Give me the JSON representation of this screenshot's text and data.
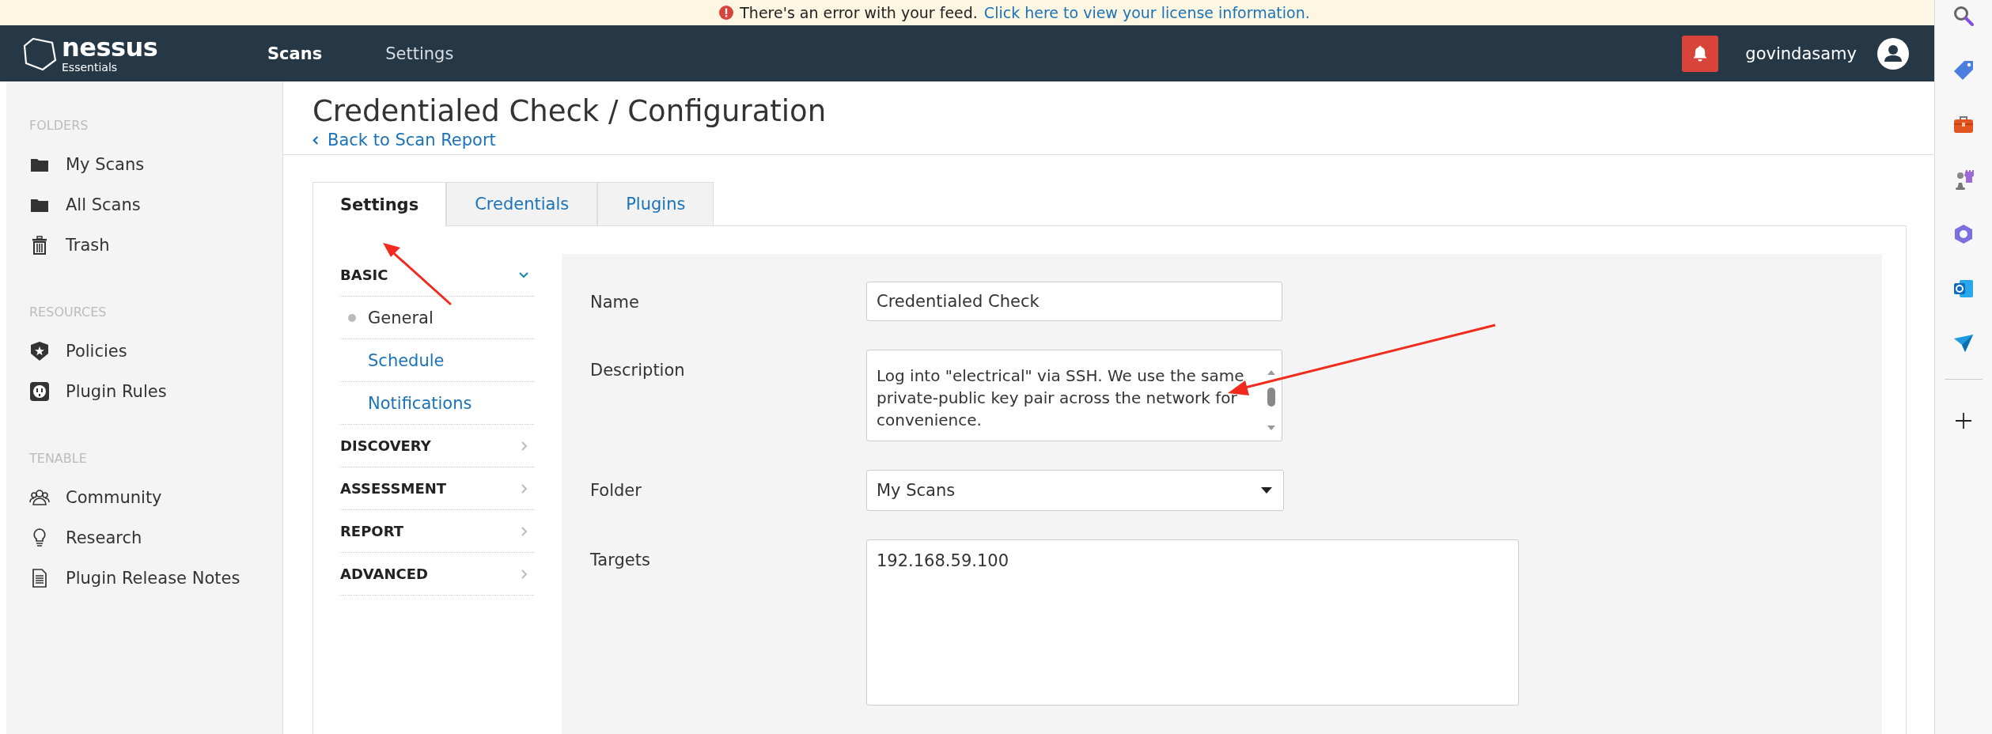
{
  "banner": {
    "message": "There's an error with your feed.",
    "link": "Click here to view your license information."
  },
  "header": {
    "logo_name": "nessus",
    "logo_edition": "Essentials",
    "nav": [
      {
        "label": "Scans",
        "selected": true
      },
      {
        "label": "Settings",
        "selected": false
      }
    ],
    "username": "govindasamy"
  },
  "sidebar": [
    {
      "heading": "FOLDERS",
      "items": [
        {
          "label": "My Scans"
        },
        {
          "label": "All Scans"
        },
        {
          "label": "Trash"
        }
      ]
    },
    {
      "heading": "RESOURCES",
      "items": [
        {
          "label": "Policies"
        },
        {
          "label": "Plugin Rules"
        }
      ]
    },
    {
      "heading": "TENABLE",
      "items": [
        {
          "label": "Community"
        },
        {
          "label": "Research"
        },
        {
          "label": "Plugin Release Notes"
        }
      ]
    }
  ],
  "page": {
    "title": "Credentialed Check / Configuration",
    "back_link": "Back to Scan Report"
  },
  "tabs": [
    {
      "label": "Settings",
      "selected": true
    },
    {
      "label": "Credentials",
      "selected": false
    },
    {
      "label": "Plugins",
      "selected": false
    }
  ],
  "menu": [
    {
      "label": "BASIC",
      "expanded": true,
      "children": [
        {
          "label": "General",
          "selected": true
        },
        {
          "label": "Schedule",
          "selected": false
        },
        {
          "label": "Notifications",
          "selected": false
        }
      ]
    },
    {
      "label": "DISCOVERY",
      "expanded": false
    },
    {
      "label": "ASSESSMENT",
      "expanded": false
    },
    {
      "label": "REPORT",
      "expanded": false
    },
    {
      "label": "ADVANCED",
      "expanded": false
    }
  ],
  "form": [
    {
      "label": "Name",
      "kind": "text",
      "value": "Credentialed Check"
    },
    {
      "label": "Description",
      "kind": "textarea",
      "value": "Log into \"electrical\" via SSH. We use the same private-public key pair across the network for convenience."
    },
    {
      "label": "Folder",
      "kind": "select",
      "value": "My Scans"
    },
    {
      "label": "Targets",
      "kind": "targets",
      "value": "192.168.59.100"
    }
  ]
}
